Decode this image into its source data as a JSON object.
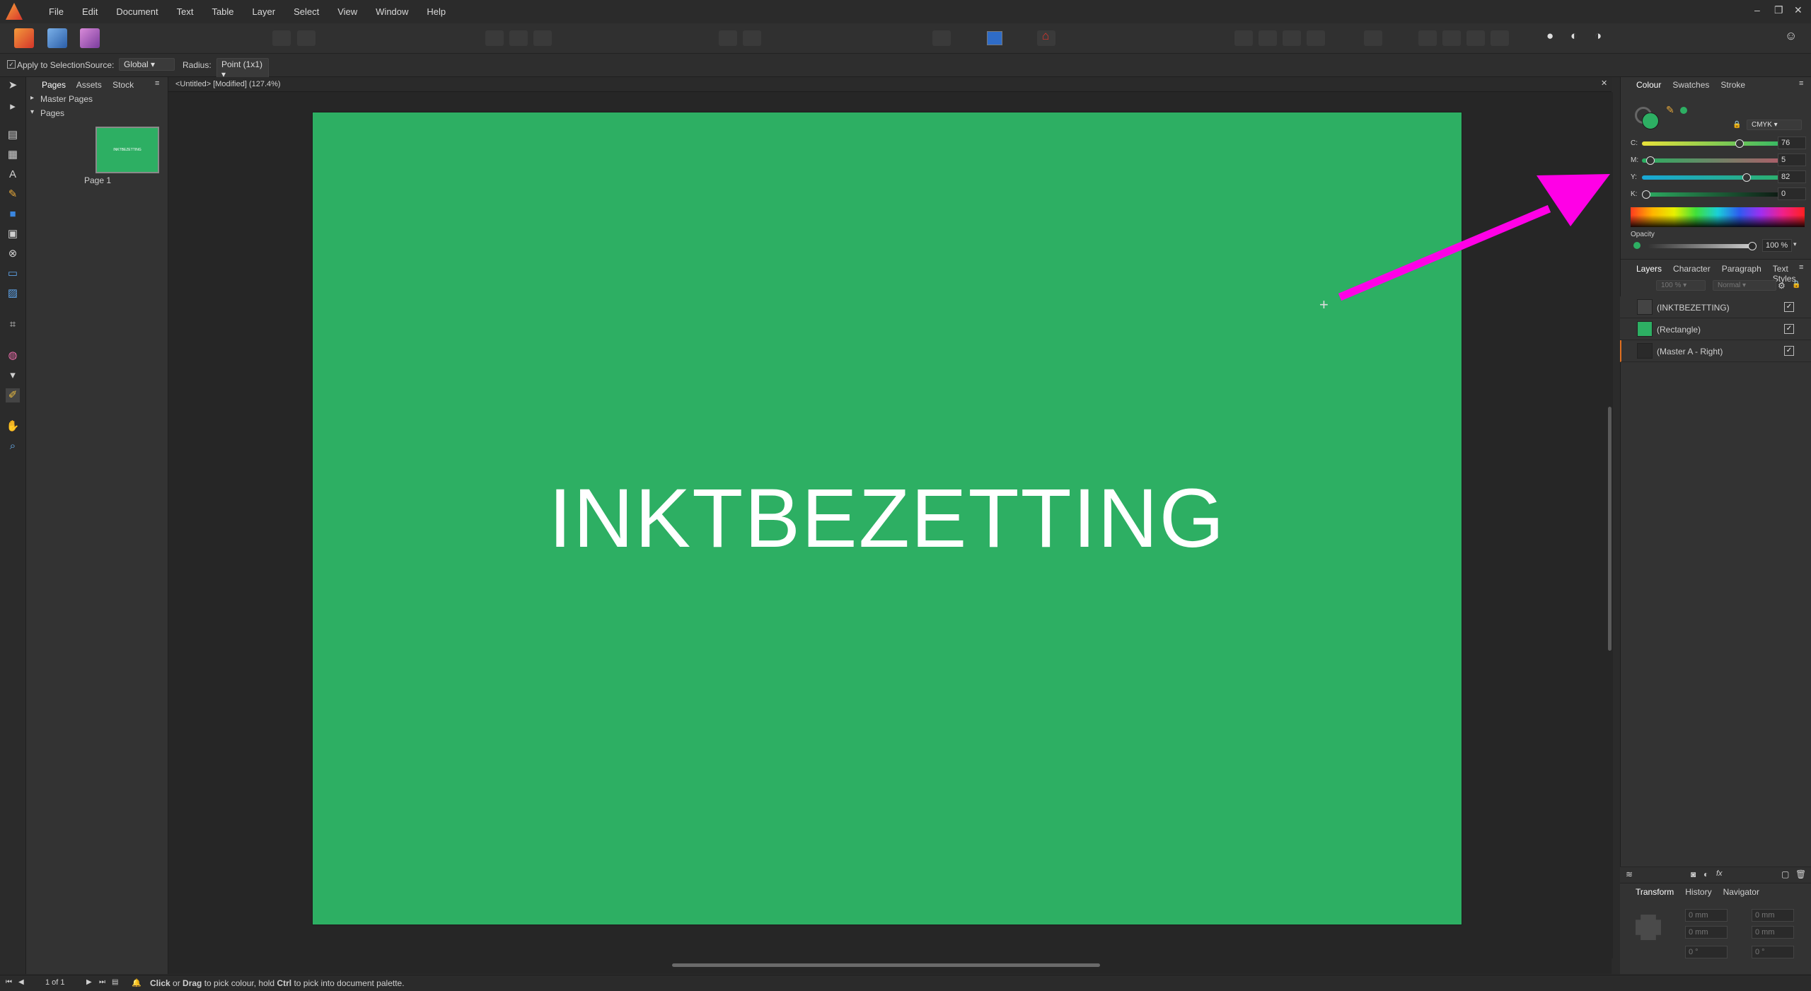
{
  "menu": [
    "File",
    "Edit",
    "Document",
    "Text",
    "Table",
    "Layer",
    "Select",
    "View",
    "Window",
    "Help"
  ],
  "context_bar": {
    "apply_label": "Apply to Selection",
    "source_label": "Source:",
    "source_value": "Global",
    "radius_label": "Radius:",
    "radius_value": "Point (1x1)"
  },
  "pages_panel": {
    "tabs": [
      "Pages",
      "Assets",
      "Stock"
    ],
    "master_pages": "Master Pages",
    "pages": "Pages",
    "page1_label": "Page 1",
    "thumb_text": "INKTBEZETTING"
  },
  "document": {
    "tab_title": "<Untitled> [Modified] (127.4%)",
    "page_text": "INKTBEZETTING",
    "page_color": "#2daf63"
  },
  "colour_panel": {
    "tabs": [
      "Colour",
      "Swatches",
      "Stroke"
    ],
    "mode": "CMYK",
    "c_label": "C:",
    "c_value": "76",
    "m_label": "M:",
    "m_value": "5",
    "y_label": "Y:",
    "y_value": "82",
    "k_label": "K:",
    "k_value": "0",
    "opacity_label": "Opacity",
    "opacity_value": "100 %"
  },
  "layers_panel": {
    "tabs": [
      "Layers",
      "Character",
      "Paragraph",
      "Text Styles"
    ],
    "opacity": "100 %",
    "blend": "Normal",
    "rows": [
      "(INKTBEZETTING)",
      "(Rectangle)",
      "(Master A - Right)"
    ]
  },
  "bottom_panel": {
    "tabs": [
      "Transform",
      "History",
      "Navigator"
    ],
    "x": "0 mm",
    "y": "0 mm",
    "w": "0 mm",
    "h": "0 mm",
    "r": "0 °",
    "s": "0 °"
  },
  "status": {
    "page_counter": "1 of 1",
    "hint_click": "Click",
    "hint_or": " or ",
    "hint_drag": "Drag",
    "hint_mid": " to pick colour, hold ",
    "hint_ctrl": "Ctrl",
    "hint_end": " to pick into document palette."
  },
  "annotation_color": "#ff00e6"
}
